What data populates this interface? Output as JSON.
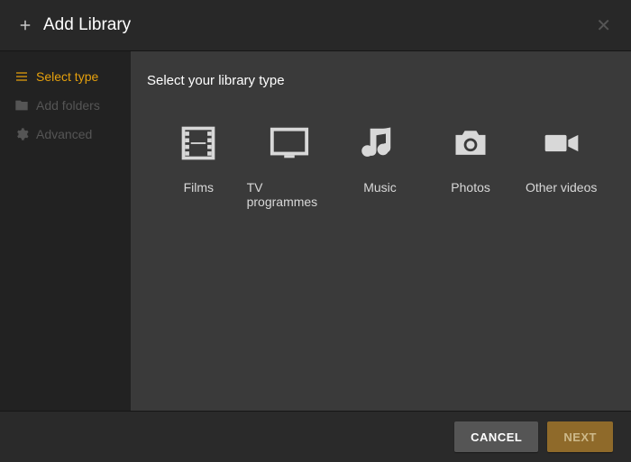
{
  "header": {
    "title": "Add Library",
    "close_icon": "close-icon"
  },
  "sidebar": {
    "items": [
      {
        "label": "Select type",
        "icon": "list-icon",
        "active": true
      },
      {
        "label": "Add folders",
        "icon": "folder-icon",
        "active": false
      },
      {
        "label": "Advanced",
        "icon": "gear-icon",
        "active": false
      }
    ]
  },
  "main": {
    "prompt": "Select your library type",
    "types": [
      {
        "label": "Films",
        "icon": "film-icon"
      },
      {
        "label": "TV programmes",
        "icon": "tv-icon"
      },
      {
        "label": "Music",
        "icon": "music-icon"
      },
      {
        "label": "Photos",
        "icon": "camera-icon"
      },
      {
        "label": "Other videos",
        "icon": "video-camera-icon"
      }
    ]
  },
  "footer": {
    "cancel_label": "CANCEL",
    "next_label": "NEXT"
  },
  "colors": {
    "accent": "#e5a00d",
    "background_dark": "#222222",
    "background_main": "#3a3a3a",
    "header_bg": "#282828"
  }
}
